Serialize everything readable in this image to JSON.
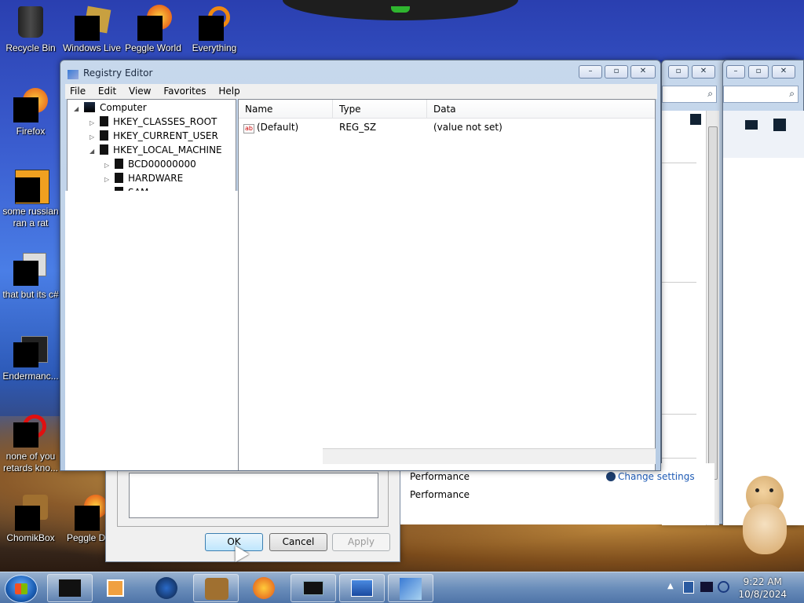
{
  "desktop": {
    "icons": [
      {
        "label": "Recycle Bin"
      },
      {
        "label": "Windows Live"
      },
      {
        "label": "Peggle World"
      },
      {
        "label": "Everything"
      },
      {
        "label": "Firefox"
      },
      {
        "label": "some russian ran a rat"
      },
      {
        "label": "that but its c#"
      },
      {
        "label": "Endermanc..."
      },
      {
        "label": "none of you retards kno..."
      },
      {
        "label": "ChomikBox"
      },
      {
        "label": "Peggle De"
      }
    ]
  },
  "regedit": {
    "title": "Registry Editor",
    "menu": [
      "File",
      "Edit",
      "View",
      "Favorites",
      "Help"
    ],
    "tree": {
      "root": "Computer",
      "items": [
        "HKEY_CLASSES_ROOT",
        "HKEY_CURRENT_USER",
        "HKEY_LOCAL_MACHINE"
      ],
      "children": [
        "BCD00000000",
        "HARDWARE",
        "SAM"
      ]
    },
    "columns": [
      "Name",
      "Type",
      "Data"
    ],
    "rows": [
      {
        "name": "(Default)",
        "type": "REG_SZ",
        "data": "(value not set)"
      }
    ]
  },
  "props_dialog": {
    "ok": "OK",
    "cancel": "Cancel",
    "apply": "Apply"
  },
  "performance": {
    "label1": "Performance",
    "label2": "Performance",
    "link": "Change settings"
  },
  "clock": {
    "time": "9:22 AM",
    "date": "10/8/2024"
  }
}
